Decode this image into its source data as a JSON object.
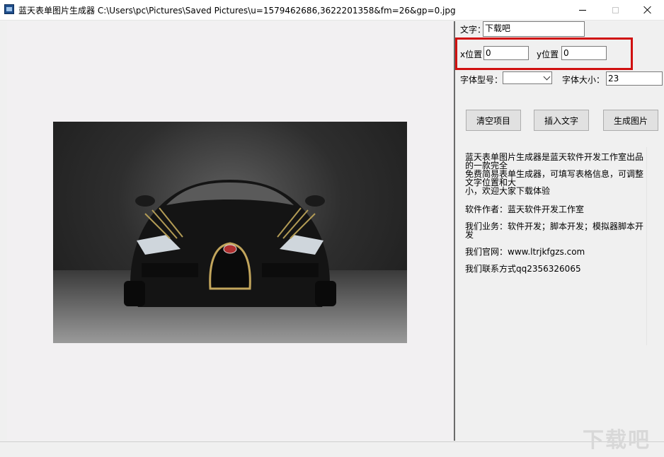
{
  "window": {
    "title": "蓝天表单图片生成器  C:\\Users\\pc\\Pictures\\Saved Pictures\\u=1579462686,3622201358&fm=26&gp=0.jpg",
    "icon": "app-icon"
  },
  "controls": {
    "text_label": "文字：",
    "text_value": "下载吧",
    "x_label": "x位置",
    "x_value": "0",
    "y_label": "y位置",
    "y_value": "0",
    "font_type_label": "字体型号：",
    "font_type_value": "",
    "font_size_label": "字体大小：",
    "font_size_value": "23"
  },
  "buttons": {
    "clear": "清空项目",
    "insert": "插入文字",
    "generate": "生成图片"
  },
  "info": {
    "lines": [
      "蓝天表单图片生成器是蓝天软件开发工作室出品",
      "的一款完全",
      "免费简易表单生成器，可填写表格信息，可调整",
      "文字位置和大",
      "小，欢迎大家下载体验",
      "软件作者：蓝天软件开发工作室",
      "我们业务：软件开发；脚本开发；模拟器脚本开",
      "发",
      "我们官网：www.ltrjkfgzs.com",
      "我们联系方式qq2356326065"
    ]
  },
  "preview_image": {
    "icon": "car-photo"
  },
  "watermark": "下载吧",
  "colors": {
    "highlight": "#d01010"
  }
}
